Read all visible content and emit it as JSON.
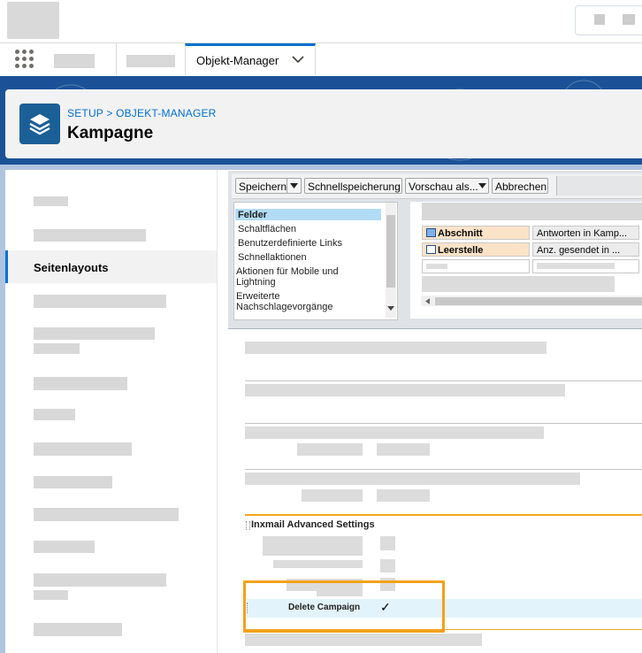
{
  "header": {
    "breadcrumb": "SETUP > OBJEKT-MANAGER",
    "title": "Kampagne"
  },
  "nav": {
    "active_tab": "Objekt-Manager"
  },
  "sidebar": {
    "active_item": "Seitenlayouts"
  },
  "toolbar": {
    "save": "Speichern",
    "quick_save": "Schnellspeicherung",
    "preview": "Vorschau als...",
    "cancel": "Abbrechen"
  },
  "palette": {
    "items": [
      "Felder",
      "Schaltflächen",
      "Benutzerdefinierte Links",
      "Schnellaktionen",
      "Aktionen für Mobile und Lightning",
      "Erweiterte Nachschlagevorgänge"
    ]
  },
  "grid": {
    "row1": [
      "Abschnitt",
      "Antworten in Kamp..."
    ],
    "row2": [
      "Leerstelle",
      "Anz. gesendet in ..."
    ]
  },
  "section": {
    "title": "Inxmail Advanced Settings",
    "field_label": "Delete Campaign",
    "field_value": "✓"
  },
  "colors": {
    "brand_blue": "#1b5297",
    "link_blue": "#0070d2",
    "highlight_orange": "#f4a11b",
    "section_line": "#f5a623"
  }
}
